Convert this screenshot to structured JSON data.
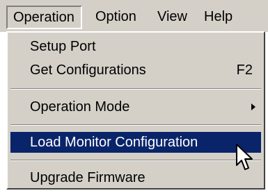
{
  "menubar": {
    "items": [
      {
        "label": "Operation",
        "state": "open"
      },
      {
        "label": "Option"
      },
      {
        "label": "View"
      },
      {
        "label": "Help"
      }
    ]
  },
  "dropdown": {
    "items": [
      {
        "label": "Setup Port"
      },
      {
        "label": "Get Configurations",
        "shortcut": "F2"
      },
      {
        "label": "Operation Mode",
        "has_submenu": true
      },
      {
        "label": "Load Monitor Configuration",
        "state": "highlighted"
      },
      {
        "label": "Upgrade Firmware"
      }
    ]
  },
  "colors": {
    "menu_background": "#d4d0c8",
    "highlight_background": "#0a246a",
    "highlight_text": "#ffffff"
  },
  "cursor": {
    "icon": "arrow-cursor-icon"
  }
}
